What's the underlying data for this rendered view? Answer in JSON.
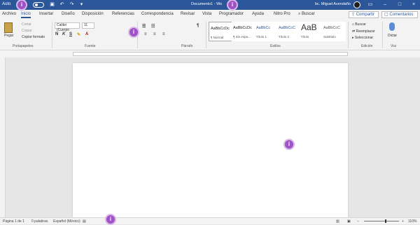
{
  "titlebar": {
    "autosave": "Auto",
    "doc_title": "Documento1 - Wo",
    "user_name": "bc. Miguel Avendaño"
  },
  "tabs": [
    "Archivo",
    "Inicio",
    "Insertar",
    "Diseño",
    "Disposición",
    "Referencias",
    "Correspondencia",
    "Revisar",
    "Vista",
    "Programador",
    "Ayuda",
    "Nitro Pro"
  ],
  "search": {
    "label": "Buscar"
  },
  "actions": {
    "share": "Compartir",
    "comments": "Comentarios"
  },
  "ribbon": {
    "clipboard": {
      "paste": "Pegar",
      "cut": "Cortar",
      "copy": "Copiar",
      "format_painter": "Copiar formato",
      "label": "Portapapeles"
    },
    "font": {
      "family": "Calibri (Cuerpo",
      "size": "11",
      "label": "Fuente"
    },
    "paragraph": {
      "label": "Párrafo"
    },
    "styles": {
      "label": "Estilos",
      "items": [
        {
          "sample": "AaBbCcDc",
          "name": "¶ Normal"
        },
        {
          "sample": "AaBbCcDc",
          "name": "¶ Sin espa..."
        },
        {
          "sample": "AaBbCc",
          "name": "Título 1"
        },
        {
          "sample": "AaBbCcC",
          "name": "Título 2"
        },
        {
          "sample": "AaB",
          "name": "Título"
        },
        {
          "sample": "AaBbCcC",
          "name": "Subtítulo"
        }
      ]
    },
    "editing": {
      "find": "Buscar",
      "replace": "Reemplazar",
      "select": "Seleccionar",
      "label": "Edición"
    },
    "voice": {
      "dictate": "Dictar",
      "label": "Voz"
    }
  },
  "status": {
    "page": "Página 1 de 1",
    "words": "0 palabras",
    "language": "Español (México)",
    "zoom": "110%",
    "zoom_level": 110
  },
  "markers": [
    "i",
    "i",
    "i",
    "i",
    "i"
  ],
  "colors": {
    "accent": "#2b579a",
    "marker": "#a052c7"
  }
}
